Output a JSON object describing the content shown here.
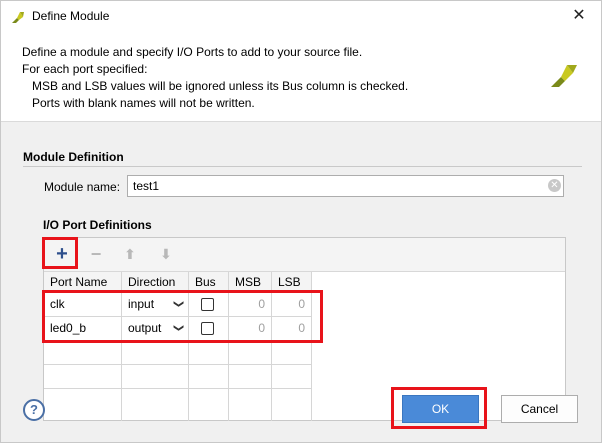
{
  "window": {
    "title": "Define Module",
    "close_glyph": "✕"
  },
  "description": {
    "line1": "Define a module and specify I/O Ports to add to your source file.",
    "line2": "For each port specified:",
    "line3": "MSB and LSB values will be ignored unless its Bus column is checked.",
    "line4": "Ports with blank names will not be written."
  },
  "module_definition": {
    "title": "Module Definition",
    "name_label": "Module name:",
    "name_value": "test1"
  },
  "io_ports": {
    "title": "I/O Port Definitions",
    "toolbar": {
      "add_glyph": "+",
      "remove_glyph": "−",
      "up_glyph": "⬆",
      "down_glyph": "⬇"
    },
    "columns": [
      "Port Name",
      "Direction",
      "Bus",
      "MSB",
      "LSB"
    ],
    "rows": [
      {
        "name": "clk",
        "direction": "input",
        "bus": false,
        "msb": "0",
        "lsb": "0"
      },
      {
        "name": "led0_b",
        "direction": "output",
        "bus": false,
        "msb": "0",
        "lsb": "0"
      }
    ]
  },
  "footer": {
    "help_glyph": "?",
    "ok_label": "OK",
    "cancel_label": "Cancel"
  },
  "colors": {
    "accent_blue": "#4a8ad8",
    "highlight_red": "#e8131a",
    "add_icon_blue": "#2e4f8c"
  }
}
